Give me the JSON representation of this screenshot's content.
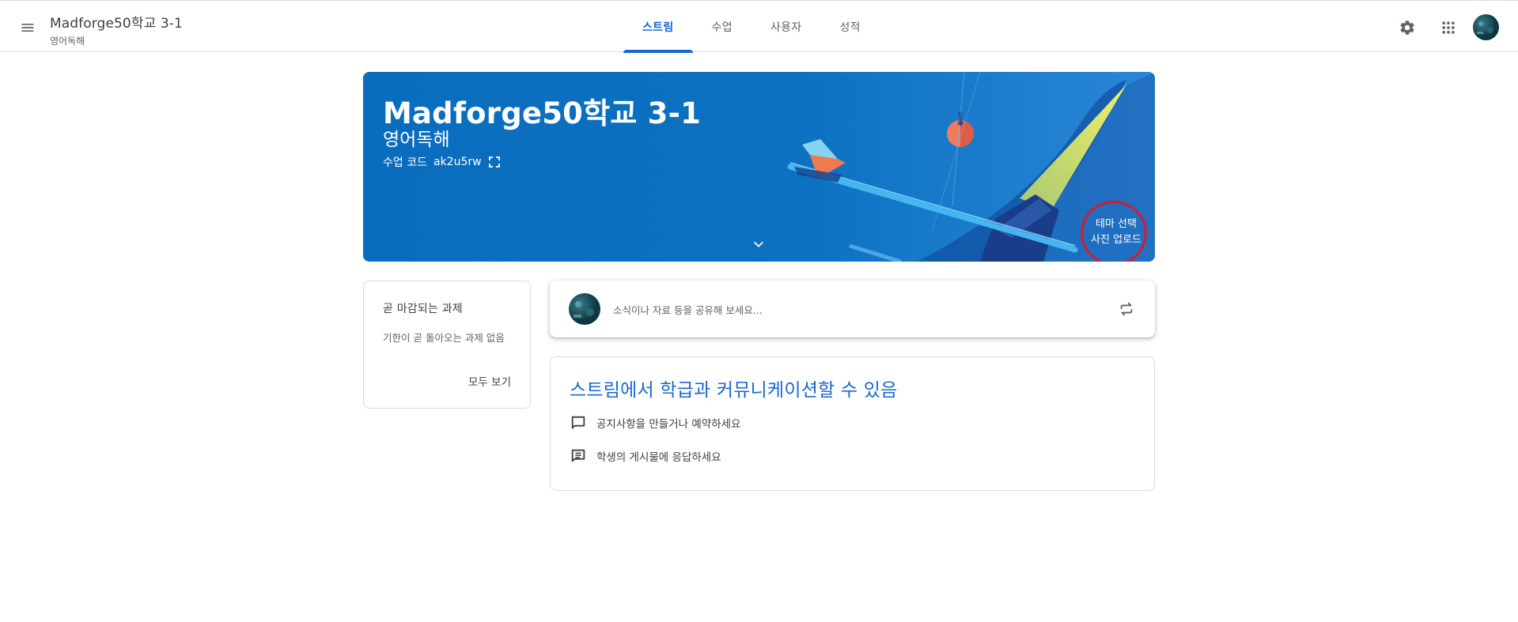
{
  "header": {
    "class_title": "Madforge50학교 3-1",
    "class_subtitle": "영어독해",
    "tabs": [
      {
        "label": "스트림",
        "active": true
      },
      {
        "label": "수업",
        "active": false
      },
      {
        "label": "사용자",
        "active": false
      },
      {
        "label": "성적",
        "active": false
      }
    ],
    "icons": [
      "menu-icon",
      "settings-icon",
      "apps-icon",
      "account-avatar"
    ]
  },
  "banner": {
    "title": "Madforge50학교 3-1",
    "subtitle": "영어독해",
    "code_label": "수업 코드",
    "code_value": "ak2u5rw",
    "theme_select": "테마 선택",
    "photo_upload": "사진 업로드",
    "background_color": "#0b6fbf"
  },
  "upcoming": {
    "title": "곧 마감되는 과제",
    "empty_text": "기한이 곧 돌아오는 과제 없음",
    "view_all": "모두 보기"
  },
  "share": {
    "placeholder": "소식이나 자료 등을 공유해 보세요..."
  },
  "info": {
    "title": "스트림에서 학급과 커뮤니케이션할 수 있음",
    "items": [
      {
        "icon": "announcement-icon",
        "text": "공지사항을 만들거나 예약하세요"
      },
      {
        "icon": "comment-icon",
        "text": "학생의 게시물에 응답하세요"
      }
    ]
  },
  "colors": {
    "accent": "#1967d2",
    "banner": "#0b6fbf",
    "annotation_circle": "#d81b28"
  }
}
